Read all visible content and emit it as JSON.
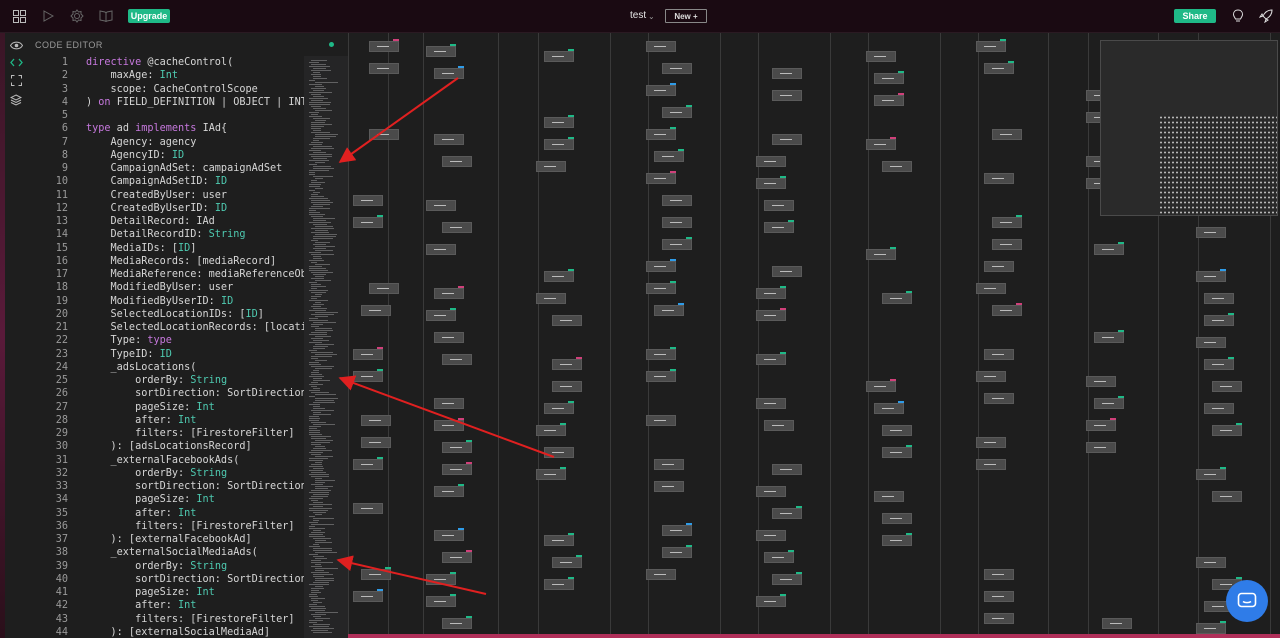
{
  "topbar": {
    "upgrade_label": "Upgrade",
    "file_name": "test",
    "new_label": "New +",
    "share_label": "Share",
    "icons": [
      "grid-icon",
      "play-icon",
      "settings-icon",
      "book-icon",
      "lightbulb-icon",
      "rocket-icon"
    ]
  },
  "left_rail": {
    "icons": [
      "eye-icon",
      "code-icon",
      "expand-icon",
      "layers-icon"
    ]
  },
  "editor": {
    "title": "CODE EDITOR",
    "lines": [
      {
        "n": "1",
        "t": [
          [
            "kw",
            "directive"
          ],
          [
            "",
            " @cacheControl("
          ]
        ]
      },
      {
        "n": "2",
        "t": [
          [
            "",
            "    maxAge: "
          ],
          [
            "ty",
            "Int"
          ]
        ]
      },
      {
        "n": "3",
        "t": [
          [
            "",
            "    scope: CacheControlScope"
          ]
        ]
      },
      {
        "n": "4",
        "t": [
          [
            "",
            ") "
          ],
          [
            "kw",
            "on"
          ],
          [
            "",
            " FIELD_DEFINITION | OBJECT | INTE"
          ]
        ]
      },
      {
        "n": "5",
        "t": [
          [
            "",
            ""
          ]
        ]
      },
      {
        "n": "6",
        "t": [
          [
            "kw",
            "type"
          ],
          [
            "",
            " ad "
          ],
          [
            "kw",
            "implements"
          ],
          [
            "",
            " IAd{"
          ]
        ]
      },
      {
        "n": "7",
        "t": [
          [
            "",
            "    Agency: agency"
          ]
        ]
      },
      {
        "n": "8",
        "t": [
          [
            "",
            "    AgencyID: "
          ],
          [
            "ty",
            "ID"
          ]
        ]
      },
      {
        "n": "9",
        "t": [
          [
            "",
            "    CampaignAdSet: campaignAdSet"
          ]
        ]
      },
      {
        "n": "10",
        "t": [
          [
            "",
            "    CampaignAdSetID: "
          ],
          [
            "ty",
            "ID"
          ]
        ]
      },
      {
        "n": "11",
        "t": [
          [
            "",
            "    CreatedByUser: user"
          ]
        ]
      },
      {
        "n": "12",
        "t": [
          [
            "",
            "    CreatedByUserID: "
          ],
          [
            "ty",
            "ID"
          ]
        ]
      },
      {
        "n": "13",
        "t": [
          [
            "",
            "    DetailRecord: IAd"
          ]
        ]
      },
      {
        "n": "14",
        "t": [
          [
            "",
            "    DetailRecordID: "
          ],
          [
            "ty",
            "String"
          ]
        ]
      },
      {
        "n": "15",
        "t": [
          [
            "",
            "    MediaIDs: ["
          ],
          [
            "ty",
            "ID"
          ],
          [
            "",
            "]"
          ]
        ]
      },
      {
        "n": "16",
        "t": [
          [
            "",
            "    MediaRecords: [mediaRecord]"
          ]
        ]
      },
      {
        "n": "17",
        "t": [
          [
            "",
            "    MediaReference: mediaReferenceObj"
          ]
        ]
      },
      {
        "n": "18",
        "t": [
          [
            "",
            "    ModifiedByUser: user"
          ]
        ]
      },
      {
        "n": "19",
        "t": [
          [
            "",
            "    ModifiedByUserID: "
          ],
          [
            "ty",
            "ID"
          ]
        ]
      },
      {
        "n": "20",
        "t": [
          [
            "",
            "    SelectedLocationIDs: ["
          ],
          [
            "ty",
            "ID"
          ],
          [
            "",
            "]"
          ]
        ]
      },
      {
        "n": "21",
        "t": [
          [
            "",
            "    SelectedLocationRecords: [locatio"
          ]
        ]
      },
      {
        "n": "22",
        "t": [
          [
            "",
            "    Type: "
          ],
          [
            "kw",
            "type"
          ]
        ]
      },
      {
        "n": "23",
        "t": [
          [
            "",
            "    TypeID: "
          ],
          [
            "ty",
            "ID"
          ]
        ]
      },
      {
        "n": "24",
        "t": [
          [
            "",
            "    _adsLocations("
          ]
        ]
      },
      {
        "n": "25",
        "t": [
          [
            "",
            "        orderBy: "
          ],
          [
            "ty",
            "String"
          ]
        ]
      },
      {
        "n": "26",
        "t": [
          [
            "",
            "        sortDirection: SortDirection"
          ]
        ]
      },
      {
        "n": "27",
        "t": [
          [
            "",
            "        pageSize: "
          ],
          [
            "ty",
            "Int"
          ]
        ]
      },
      {
        "n": "28",
        "t": [
          [
            "",
            "        after: "
          ],
          [
            "ty",
            "Int"
          ]
        ]
      },
      {
        "n": "29",
        "t": [
          [
            "",
            "        filters: [FirestoreFilter]"
          ]
        ]
      },
      {
        "n": "30",
        "t": [
          [
            "",
            "    ): [adsLocationsRecord]"
          ]
        ]
      },
      {
        "n": "31",
        "t": [
          [
            "",
            "    _externalFacebookAds("
          ]
        ]
      },
      {
        "n": "32",
        "t": [
          [
            "",
            "        orderBy: "
          ],
          [
            "ty",
            "String"
          ]
        ]
      },
      {
        "n": "33",
        "t": [
          [
            "",
            "        sortDirection: SortDirection"
          ]
        ]
      },
      {
        "n": "34",
        "t": [
          [
            "",
            "        pageSize: "
          ],
          [
            "ty",
            "Int"
          ]
        ]
      },
      {
        "n": "35",
        "t": [
          [
            "",
            "        after: "
          ],
          [
            "ty",
            "Int"
          ]
        ]
      },
      {
        "n": "36",
        "t": [
          [
            "",
            "        filters: [FirestoreFilter]"
          ]
        ]
      },
      {
        "n": "37",
        "t": [
          [
            "",
            "    ): [externalFacebookAd]"
          ]
        ]
      },
      {
        "n": "38",
        "t": [
          [
            "",
            "    _externalSocialMediaAds("
          ]
        ]
      },
      {
        "n": "39",
        "t": [
          [
            "",
            "        orderBy: "
          ],
          [
            "ty",
            "String"
          ]
        ]
      },
      {
        "n": "40",
        "t": [
          [
            "",
            "        sortDirection: SortDirection"
          ]
        ]
      },
      {
        "n": "41",
        "t": [
          [
            "",
            "        pageSize: "
          ],
          [
            "ty",
            "Int"
          ]
        ]
      },
      {
        "n": "42",
        "t": [
          [
            "",
            "        after: "
          ],
          [
            "ty",
            "Int"
          ]
        ]
      },
      {
        "n": "43",
        "t": [
          [
            "",
            "        filters: [FirestoreFilter]"
          ]
        ]
      },
      {
        "n": "44",
        "t": [
          [
            "",
            "    ): [externalSocialMediaAd]"
          ]
        ]
      }
    ]
  },
  "colors": {
    "accent": "#1fb987",
    "keyword": "#c678dd",
    "type": "#4ec9b0",
    "annotation_arrow": "#e02020",
    "chat": "#2f7ce8"
  }
}
